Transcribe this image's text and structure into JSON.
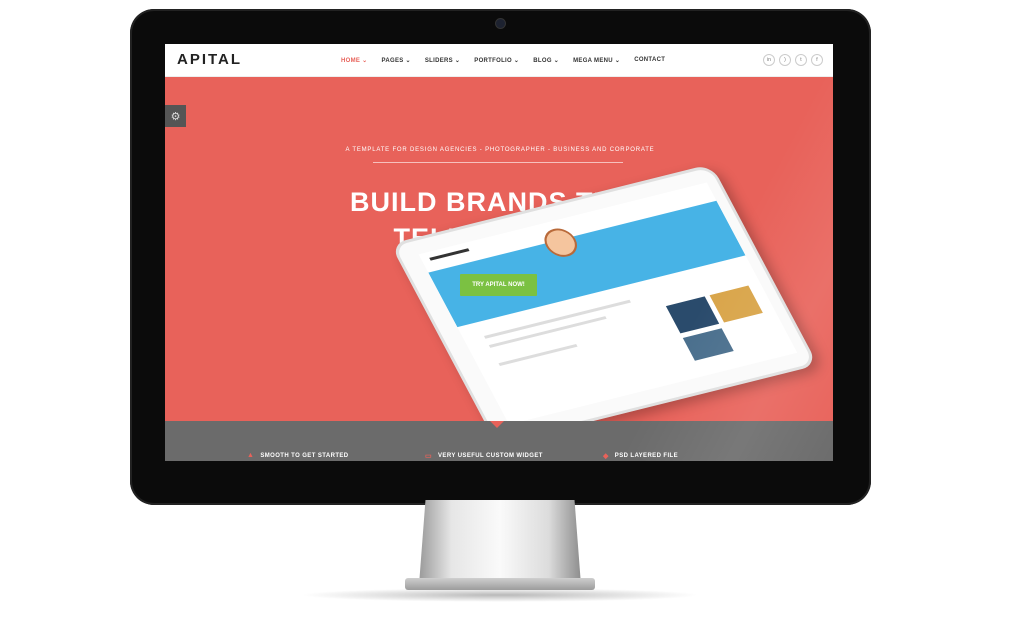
{
  "site": {
    "logo": "APITAL"
  },
  "nav": {
    "items": [
      {
        "label": "HOME ⌄",
        "active": true
      },
      {
        "label": "PAGES ⌄",
        "active": false
      },
      {
        "label": "SLIDERS ⌄",
        "active": false
      },
      {
        "label": "PORTFOLIO ⌄",
        "active": false
      },
      {
        "label": "BLOG ⌄",
        "active": false
      },
      {
        "label": "MEGA MENU ⌄",
        "active": false
      },
      {
        "label": "CONTACT",
        "active": false
      }
    ]
  },
  "social": [
    {
      "icon": "linkedin-icon",
      "glyph": "in"
    },
    {
      "icon": "rss-icon",
      "glyph": ")"
    },
    {
      "icon": "twitter-icon",
      "glyph": "t"
    },
    {
      "icon": "facebook-icon",
      "glyph": "f"
    }
  ],
  "hero": {
    "tagline": "A TEMPLATE FOR DESIGN AGENCIES - PHOTOGRAPHER - BUSINESS AND CORPORATE",
    "headline_line1": "BUILD BRANDS THAT",
    "headline_line2": "TELL A STORY!",
    "cta_label": "TRY APITAL NOW!"
  },
  "features": [
    {
      "icon": "chart-icon",
      "label": "SMOOTH TO GET STARTED"
    },
    {
      "icon": "widget-icon",
      "label": "VERY USEFUL CUSTOM WIDGET"
    },
    {
      "icon": "layers-icon",
      "label": "PSD LAYERED FILE"
    }
  ],
  "colors": {
    "accent": "#e8625a",
    "cta": "#7bc142",
    "features_bar": "#6b6b6b"
  }
}
